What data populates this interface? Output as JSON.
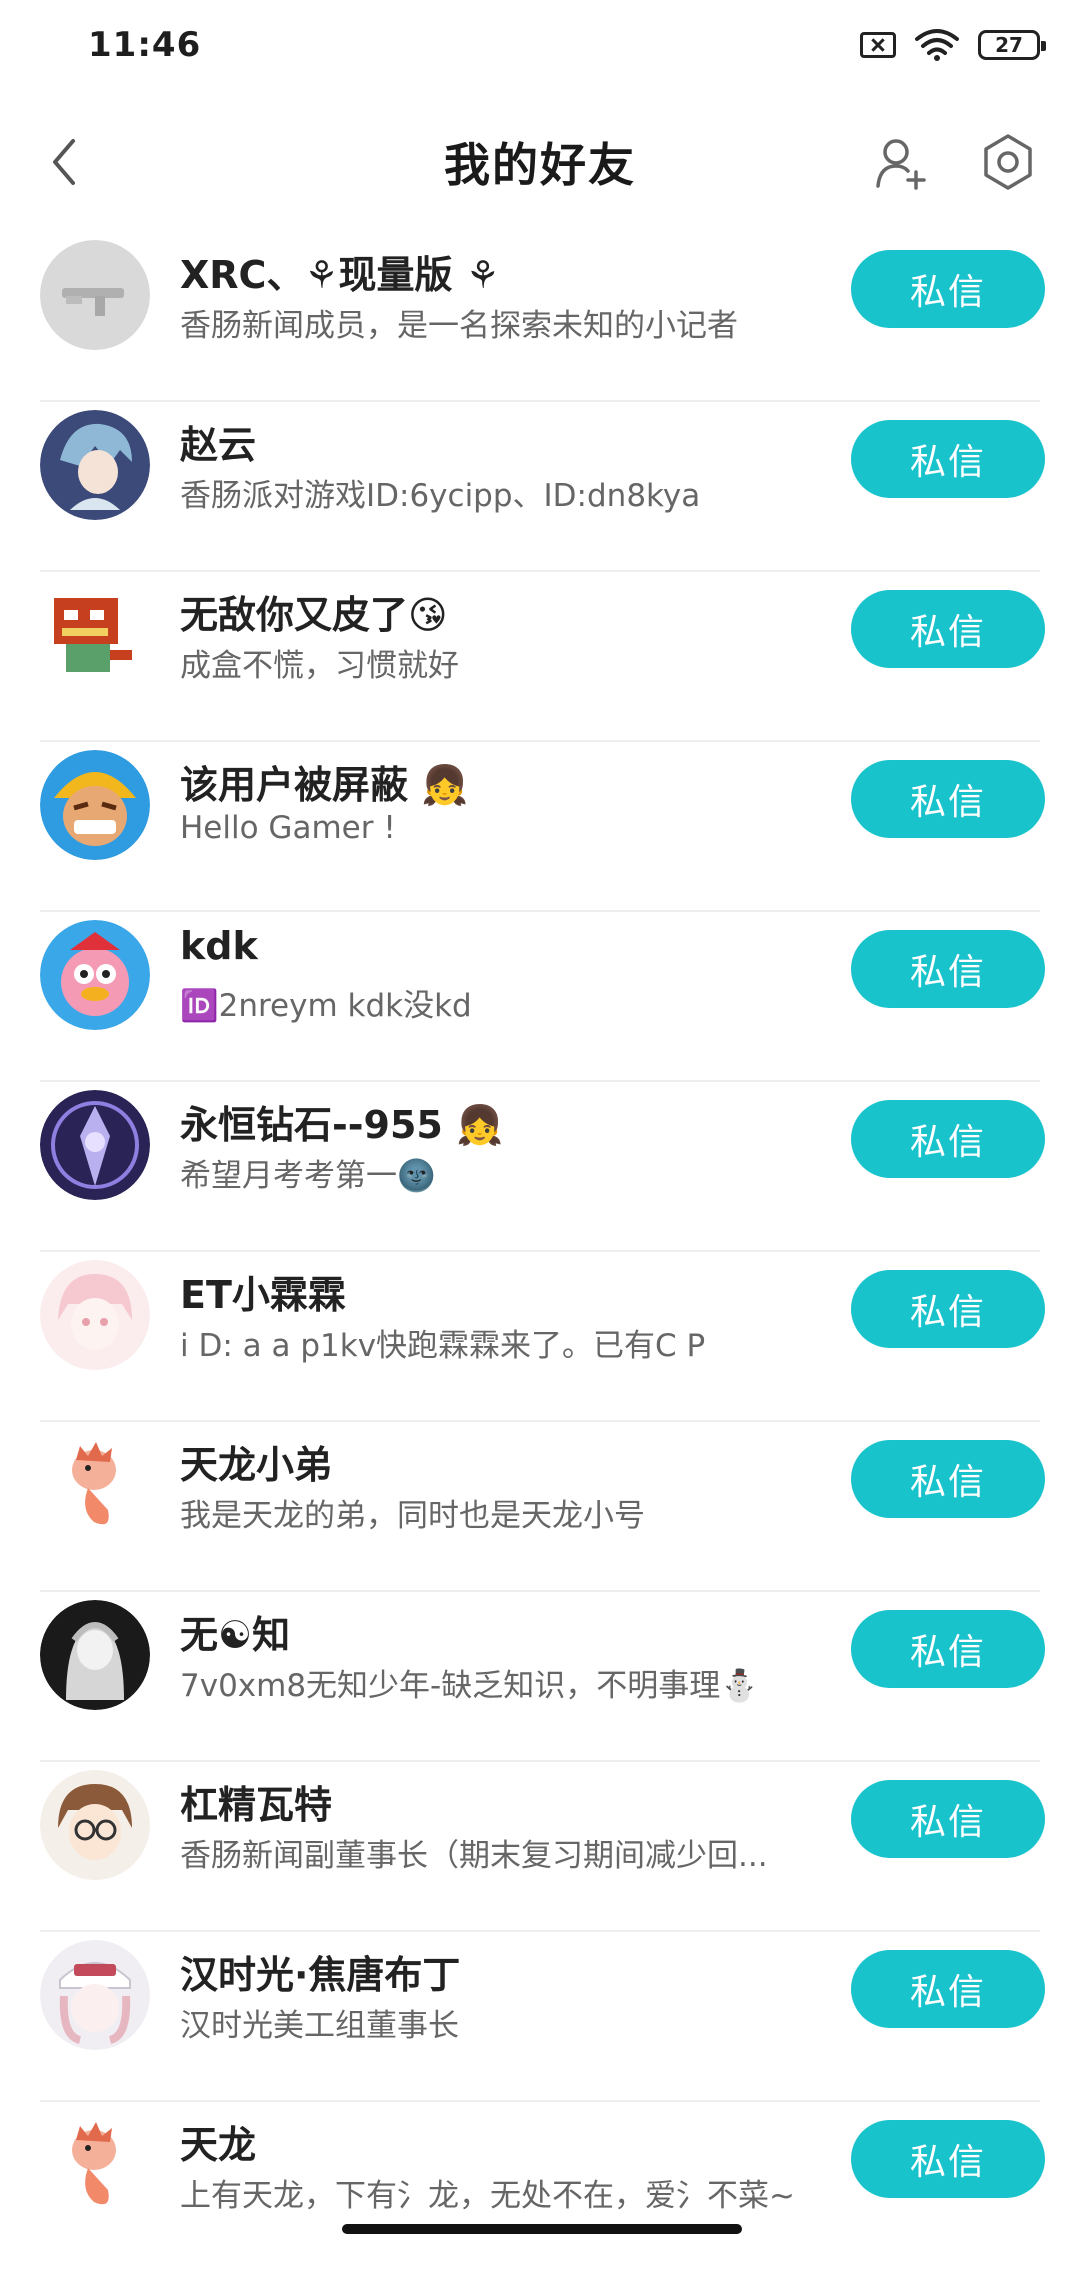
{
  "status_bar": {
    "time": "11:46",
    "battery": "27",
    "icons": [
      "sim-off-icon",
      "wifi-icon",
      "battery-icon"
    ]
  },
  "header": {
    "title": "我的好友",
    "back_icon": "chevron-left-icon",
    "add_friend_icon": "add-user-icon",
    "settings_icon": "hexagon-settings-icon"
  },
  "friends": [
    {
      "name": "XRC、⚘现量版 ⚘",
      "bio": "香肠新闻成员，是一名探索未知的小记者",
      "button": "私信"
    },
    {
      "name": "赵云",
      "bio": "香肠派对游戏ID:6ycipp、ID:dn8kya",
      "button": "私信"
    },
    {
      "name": "无敌你又皮了😘",
      "bio": "成盒不慌，习惯就好",
      "button": "私信"
    },
    {
      "name": "该用户被屏蔽 👧",
      "bio": "Hello Gamer !",
      "button": "私信"
    },
    {
      "name": "kdk",
      "bio": "🆔2nreym  kdk没kd",
      "button": "私信"
    },
    {
      "name": "永恒钻石--955 👧",
      "bio": "希望月考考第一🌚",
      "button": "私信"
    },
    {
      "name": "ET小霖霖",
      "bio": "i D: a a p1kv快跑霖霖来了。已有C P",
      "button": "私信"
    },
    {
      "name": "天龙小弟",
      "bio": "我是天龙的弟，同时也是天龙小号",
      "button": "私信"
    },
    {
      "name": "无☯知",
      "bio": "7v0xm8无知少年-缺乏知识，不明事理⛄",
      "button": "私信"
    },
    {
      "name": "杠精瓦特",
      "bio": "香肠新闻副董事长（期末复习期间减少回...",
      "button": "私信"
    },
    {
      "name": "汉时光·焦唐布丁",
      "bio": "汉时光美工组董事长",
      "button": "私信"
    },
    {
      "name": "天龙",
      "bio": "上有天龙，下有氵龙，无处不在，爱氵不菜~",
      "button": "私信"
    }
  ],
  "colors": {
    "accent": "#19c3cc",
    "text_primary": "#222222",
    "text_secondary": "#666666",
    "divider": "#eeeeee"
  }
}
